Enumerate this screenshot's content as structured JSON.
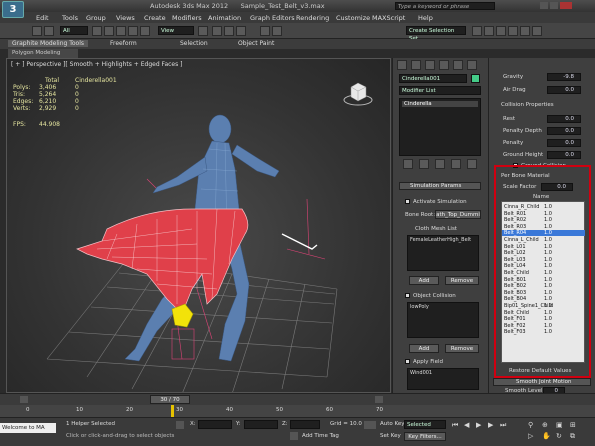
{
  "app": {
    "title": "Autodesk 3ds Max  2012",
    "file": "Sample_Test_Belt_v3.max",
    "search_placeholder": "Type a keyword or phrase"
  },
  "menu": [
    "Edit",
    "Tools",
    "Group",
    "Views",
    "Create",
    "Modifiers",
    "Animation",
    "Graph Editors",
    "Rendering",
    "Customize",
    "MAXScript",
    "Help"
  ],
  "toolbar": {
    "selection_filter": "All",
    "view_dropdown": "View",
    "named_selection": "Create Selection Set"
  },
  "ribbon": {
    "tabs": [
      "Graphite Modeling Tools",
      "Freeform",
      "Selection",
      "Object Paint"
    ],
    "sub_tab": "Polygon Modeling"
  },
  "viewport": {
    "label": "[ + ] Perspective ][ Smooth + Highlights + Edged Faces ]",
    "stats": {
      "header_total": "Total",
      "header_object": "Cinderella001",
      "polys_label": "Polys:",
      "polys_total": "3,406",
      "polys_obj": "0",
      "tris_label": "Tris:",
      "tris_total": "5,264",
      "tris_obj": "0",
      "edges_label": "Edges:",
      "edges_total": "6,210",
      "edges_obj": "0",
      "verts_label": "Verts:",
      "verts_total": "2,929",
      "verts_obj": "0",
      "fps_label": "FPS:",
      "fps_value": "44.908"
    }
  },
  "modify_panel": {
    "object_name": "Cinderella001",
    "modifier_list_label": "Modifier List",
    "stack_item": "Cinderella",
    "sim_params_header": "Simulation Params",
    "activate_sim_label": "Activate Simulation",
    "bone_root_label": "Bone Root:",
    "bone_root_value": "ath_Top_Dummi",
    "cloth_mesh_label": "Cloth Mesh List",
    "cloth_mesh_item": "FemaleLeatherHigh_Belt",
    "add_label": "Add",
    "remove_label": "Remove",
    "object_collision_label": "Object Collision",
    "collision_item": "lowPoly",
    "apply_field_label": "Apply Field",
    "field_item": "Wind001"
  },
  "params_panel": {
    "gravity_label": "Gravity",
    "gravity_value": "-9.8",
    "air_drag_label": "Air Drag",
    "air_drag_value": "0.0",
    "collision_props_header": "Collision Properties",
    "rest_label": "Rest",
    "rest_value": "0.0",
    "penalty_depth_label": "Penalty Depth",
    "penalty_depth_value": "0.0",
    "penalty_label": "Penalty",
    "penalty_value": "0.0",
    "ground_height_label": "Ground Height",
    "ground_height_value": "0.0",
    "ground_collision_label": "Ground Collision",
    "per_bone_header": "Per Bone Material",
    "scale_factor_label": "Scale Factor",
    "scale_factor_value": "0.0",
    "name_column": "Name",
    "bones": [
      {
        "name": "Cinna_R_Child",
        "val": "1.0"
      },
      {
        "name": "Belt_R01",
        "val": "1.0"
      },
      {
        "name": "Belt_R02",
        "val": "1.0"
      },
      {
        "name": "Belt_R03",
        "val": "1.0"
      },
      {
        "name": "Belt_R04",
        "val": "1.0"
      },
      {
        "name": "Cinna_L_Child",
        "val": "1.0"
      },
      {
        "name": "Belt_L01",
        "val": "1.0"
      },
      {
        "name": "Belt_L02",
        "val": "1.0"
      },
      {
        "name": "Belt_L03",
        "val": "1.0"
      },
      {
        "name": "Belt_L04",
        "val": "1.0"
      },
      {
        "name": "Belt_Child",
        "val": "1.0"
      },
      {
        "name": "Belt_B01",
        "val": "1.0"
      },
      {
        "name": "Belt_B02",
        "val": "1.0"
      },
      {
        "name": "Belt_B03",
        "val": "1.0"
      },
      {
        "name": "Belt_B04",
        "val": "1.0"
      },
      {
        "name": "Bip01_Spine1_Child",
        "val": "1.0"
      },
      {
        "name": "Belt_Child",
        "val": "1.0"
      },
      {
        "name": "Belt_F01",
        "val": "1.0"
      },
      {
        "name": "Belt_F02",
        "val": "1.0"
      },
      {
        "name": "Belt_F03",
        "val": "1.0"
      }
    ],
    "selected_bone_index": 4,
    "restore_defaults_label": "Restore Default Values",
    "smooth_joint_header": "Smooth Joint Motion",
    "smooth_level_label": "Smooth Level",
    "smooth_level_value": "0"
  },
  "timeline": {
    "frame_readout": "30 / 70",
    "ticks": [
      "0",
      "10",
      "20",
      "30",
      "40",
      "50",
      "60",
      "70"
    ]
  },
  "status": {
    "selection_text": "1 Helper Selected",
    "prompt_text": "Click or click-and-drag to select objects",
    "welcome_text": "Welcome to MA",
    "x_label": "X:",
    "y_label": "Y:",
    "z_label": "Z:",
    "grid_label": "Grid = 10.0",
    "auto_key_label": "Auto Key",
    "auto_key_value": "Selected",
    "set_key_label": "Set Key",
    "key_filters_label": "Key Filters...",
    "add_time_tag_label": "Add Time Tag"
  },
  "colors": {
    "highlight": "#d00010",
    "selection_blue": "#3a78d8",
    "cloth_red": "#e0404a",
    "figure_blue": "#5b7fb0"
  }
}
